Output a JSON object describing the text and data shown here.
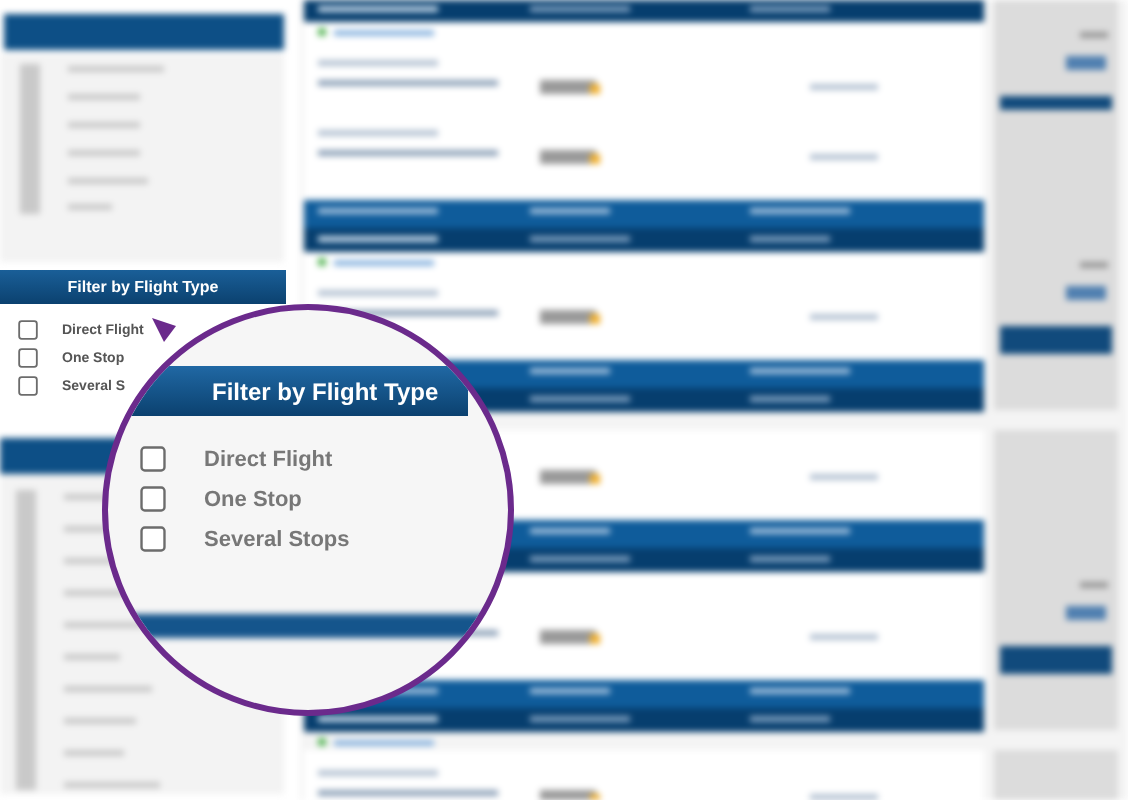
{
  "filter_panel": {
    "title": "Filter by Flight Type",
    "options": [
      {
        "label": "Direct Flight",
        "checked": false
      },
      {
        "label": "One Stop",
        "checked": false
      },
      {
        "label": "Several S",
        "checked": false
      }
    ]
  },
  "magnifier": {
    "title": "Filter by Flight Type",
    "options": [
      {
        "label": "Direct Flight",
        "checked": false
      },
      {
        "label": "One Stop",
        "checked": false
      },
      {
        "label": "Several Stops",
        "checked": false
      }
    ]
  }
}
